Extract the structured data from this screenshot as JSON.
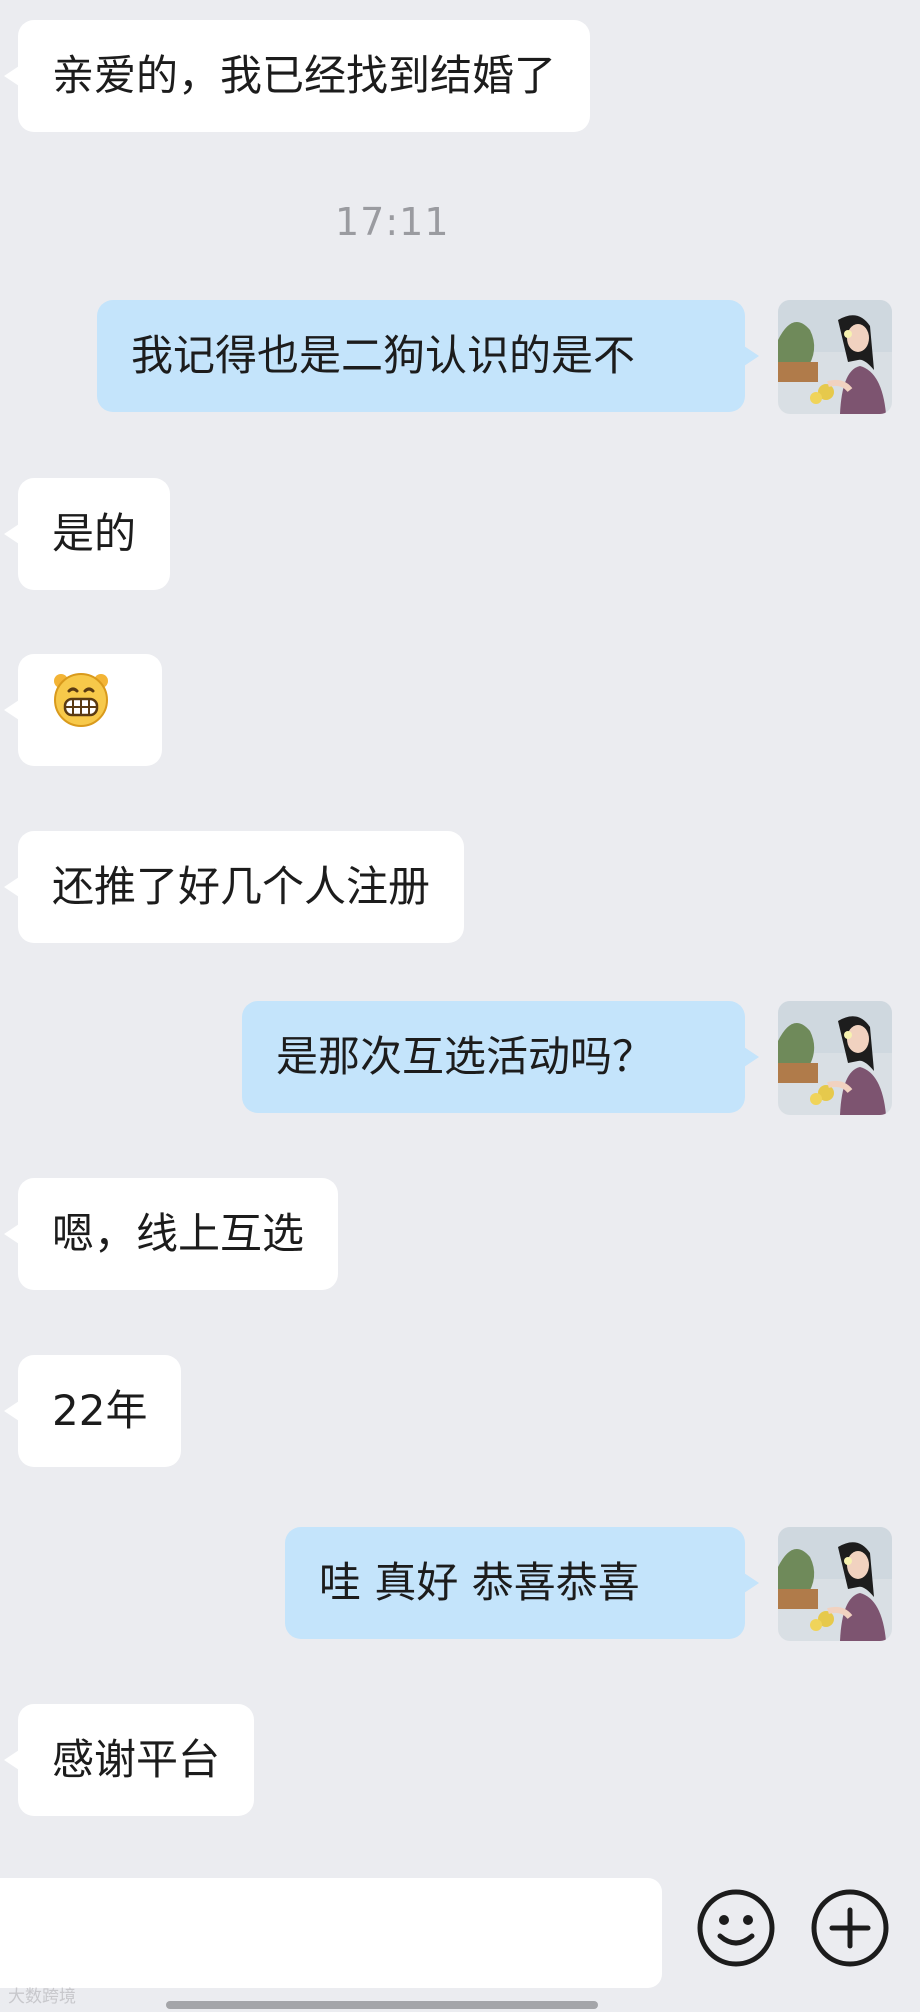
{
  "conversation": {
    "timestamp": "17:11",
    "messages": [
      {
        "side": "left",
        "text": "亲爱的，我已经找到结婚了"
      },
      {
        "side": "right",
        "text": "我记得也是二狗认识的是不"
      },
      {
        "side": "left",
        "text": "是的"
      },
      {
        "side": "left",
        "emoji": "grinning-face"
      },
      {
        "side": "left",
        "text": "还推了好几个人注册"
      },
      {
        "side": "right",
        "text": "是那次互选活动吗？"
      },
      {
        "side": "left",
        "text": "嗯，线上互选"
      },
      {
        "side": "left",
        "text": "22年"
      },
      {
        "side": "right",
        "text": "哇 真好 恭喜恭喜"
      },
      {
        "side": "left",
        "text": "感谢平台"
      }
    ]
  },
  "input_bar": {
    "value": "",
    "emoji_button_icon": "smiley-face-icon",
    "plus_button_icon": "plus-circle-icon"
  },
  "watermark": "大数跨境",
  "colors": {
    "background": "#ebecf0",
    "incoming_bubble": "#ffffff",
    "outgoing_bubble": "#c4e4fb"
  }
}
